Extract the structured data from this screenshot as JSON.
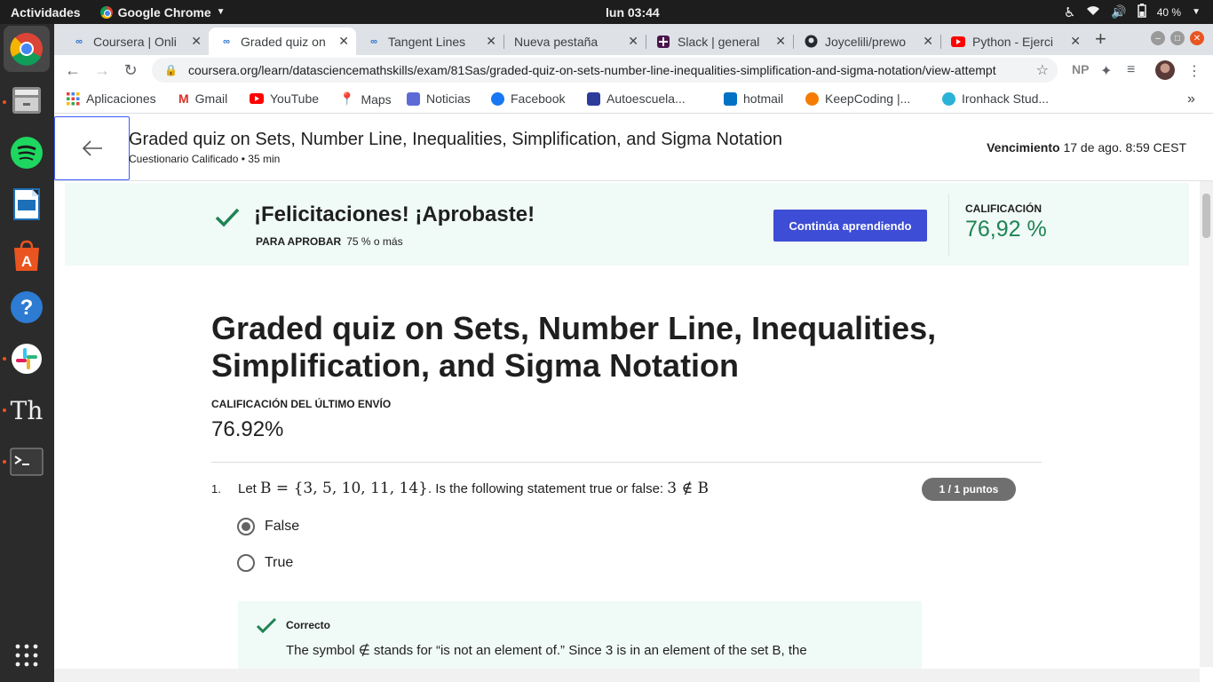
{
  "system": {
    "activities": "Actividades",
    "app_name": "Google Chrome",
    "clock": "lun 03:44",
    "battery": "40 %"
  },
  "browser": {
    "tabs": [
      {
        "title": "Coursera | Onli",
        "icon": "coursera-icon",
        "active": false
      },
      {
        "title": "Graded quiz on",
        "icon": "coursera-icon",
        "active": true
      },
      {
        "title": "Tangent Lines",
        "icon": "coursera-icon",
        "active": false
      },
      {
        "title": "Nueva pestaña",
        "icon": "",
        "active": false
      },
      {
        "title": "Slack | general",
        "icon": "slack-icon",
        "active": false
      },
      {
        "title": "Joycelili/prewo",
        "icon": "github-icon",
        "active": false
      },
      {
        "title": "Python - Ejerci",
        "icon": "youtube-icon",
        "active": false
      }
    ],
    "url": "coursera.org/learn/datasciencemathskills/exam/81Sas/graded-quiz-on-sets-number-line-inequalities-simplification-and-sigma-notation/view-attempt",
    "ext_label": "NP",
    "bookmarks": [
      {
        "label": "Aplicaciones",
        "icon": "apps-grid-icon",
        "color": "#4285f4"
      },
      {
        "label": "Gmail",
        "icon": "gmail-icon",
        "color": "#d93025"
      },
      {
        "label": "YouTube",
        "icon": "youtube-icon",
        "color": "#ff0000"
      },
      {
        "label": "Maps",
        "icon": "maps-icon",
        "color": "#34a853"
      },
      {
        "label": "Noticias",
        "icon": "news-icon",
        "color": "#5f6368"
      },
      {
        "label": "Facebook",
        "icon": "facebook-icon",
        "color": "#1877f2"
      },
      {
        "label": "Autoescuela...",
        "icon": "autoescuela-icon",
        "color": "#2d3c9a"
      },
      {
        "label": "hotmail",
        "icon": "outlook-icon",
        "color": "#0072c6"
      },
      {
        "label": "KeepCoding |...",
        "icon": "keepcoding-icon",
        "color": "#f57c00"
      },
      {
        "label": "Ironhack Stud...",
        "icon": "ironhack-icon",
        "color": "#2ab3d6"
      }
    ]
  },
  "quiz_header": {
    "title": "Graded quiz on Sets, Number Line, Inequalities, Simplification, and Sigma Notation",
    "subtitle": "Cuestionario Calificado • 35 min",
    "due_label": "Vencimiento",
    "due_value": "17 de ago. 8:59 CEST"
  },
  "banner": {
    "congrats": "¡Felicitaciones! ¡Aprobaste!",
    "pass_label": "PARA APROBAR",
    "pass_value": "75 % o más",
    "continue_label": "Continúa aprendiendo",
    "grade_label": "CALIFICACIÓN",
    "grade_value": "76,92 %",
    "accent": "#3d4dd5",
    "grade_color": "#1f8354"
  },
  "main": {
    "title": "Graded quiz on Sets, Number Line, Inequalities, Simplification, and Sigma Notation",
    "last_grade_label": "CALIFICACIÓN DEL ÚLTIMO ENVÍO",
    "last_grade_value": "76.92%"
  },
  "question": {
    "number": "1.",
    "text_prefix": "Let ",
    "math_set": "B = {3, 5, 10, 11, 14}",
    "text_mid": ". Is the following statement true or false: ",
    "math_statement": "3 ∉ B",
    "points": "1 / 1 puntos",
    "options": [
      {
        "label": "False",
        "selected": true
      },
      {
        "label": "True",
        "selected": false
      }
    ],
    "feedback_label": "Correcto",
    "feedback_text": "The symbol ∉ stands for “is not an element of.” Since 3 is in an element of the set B, the"
  }
}
